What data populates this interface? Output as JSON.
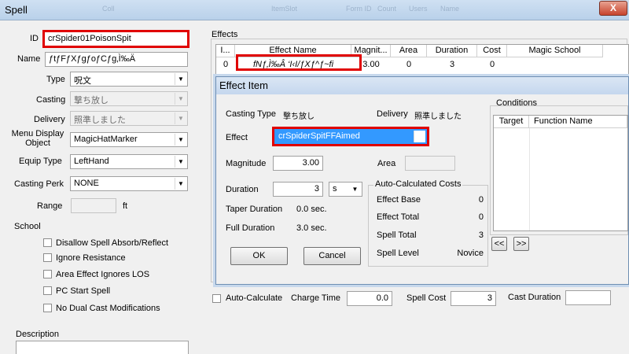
{
  "window": {
    "title": "Spell",
    "close": "X"
  },
  "ghost_tabs": [
    "Coll",
    "ItemSlot",
    "Form ID",
    "Count",
    "Users",
    "Name"
  ],
  "form": {
    "id_label": "ID",
    "id_value": "crSpider01PoisonSpit",
    "name_label": "Name",
    "name_value": "ƒtƒFƒXƒgƒoƒCƒg‚Ì‰Ä",
    "type_label": "Type",
    "type_value": "呪文",
    "casting_label": "Casting",
    "casting_value": "撃ち放し",
    "delivery_label": "Delivery",
    "delivery_value": "照準しました",
    "menu_display_label": "Menu Display Object",
    "menu_display_value": "MagicHatMarker",
    "equip_type_label": "Equip Type",
    "equip_type_value": "LeftHand",
    "casting_perk_label": "Casting Perk",
    "casting_perk_value": "NONE",
    "range_label": "Range",
    "range_unit": "ft",
    "school_label": "School",
    "checks": [
      "Disallow Spell Absorb/Reflect",
      "Ignore Resistance",
      "Area Effect Ignores LOS",
      "PC Start Spell",
      "No Dual Cast Modifications"
    ],
    "description_label": "Description"
  },
  "effects": {
    "label": "Effects",
    "columns": [
      "I...",
      "Effect Name",
      "Magnit...",
      "Area",
      "Duration",
      "Cost",
      "Magic School"
    ],
    "rows": [
      {
        "i": "0",
        "name": "fNƒ‚Ì‰Â ‘I‹I/ƒXƒ^ƒ~fi",
        "magnitude": "3.00",
        "area": "0",
        "duration": "3",
        "cost": "0",
        "school": ""
      }
    ]
  },
  "bottom": {
    "auto_calc_label": "Auto-Calculate",
    "charge_time_label": "Charge Time",
    "charge_time_value": "0.0",
    "spell_cost_label": "Spell Cost",
    "spell_cost_value": "3",
    "cast_duration_label": "Cast Duration"
  },
  "effect_item": {
    "title": "Effect Item",
    "casting_type_label": "Casting Type",
    "casting_type_value": "撃ち放し",
    "delivery_label": "Delivery",
    "delivery_value": "照準しました",
    "effect_label": "Effect",
    "effect_value": "crSpiderSpitFFAimed",
    "magnitude_label": "Magnitude",
    "magnitude_value": "3.00",
    "area_label": "Area",
    "duration_label": "Duration",
    "duration_value": "3",
    "duration_unit": "s",
    "taper_label": "Taper Duration",
    "taper_value": "0.0 sec.",
    "full_label": "Full Duration",
    "full_value": "3.0 sec.",
    "ok": "OK",
    "cancel": "Cancel",
    "auto_costs": {
      "label": "Auto-Calculated Costs",
      "effect_base_label": "Effect Base",
      "effect_base_value": "0",
      "effect_total_label": "Effect Total",
      "effect_total_value": "0",
      "spell_total_label": "Spell Total",
      "spell_total_value": "3",
      "spell_level_label": "Spell Level",
      "spell_level_value": "Novice"
    },
    "conditions": {
      "label": "Conditions",
      "columns": [
        "Target",
        "Function Name"
      ],
      "prev": "<<",
      "next": ">>"
    }
  },
  "colors": {
    "highlight_red": "#e00000",
    "selection_blue": "#3399ff"
  }
}
